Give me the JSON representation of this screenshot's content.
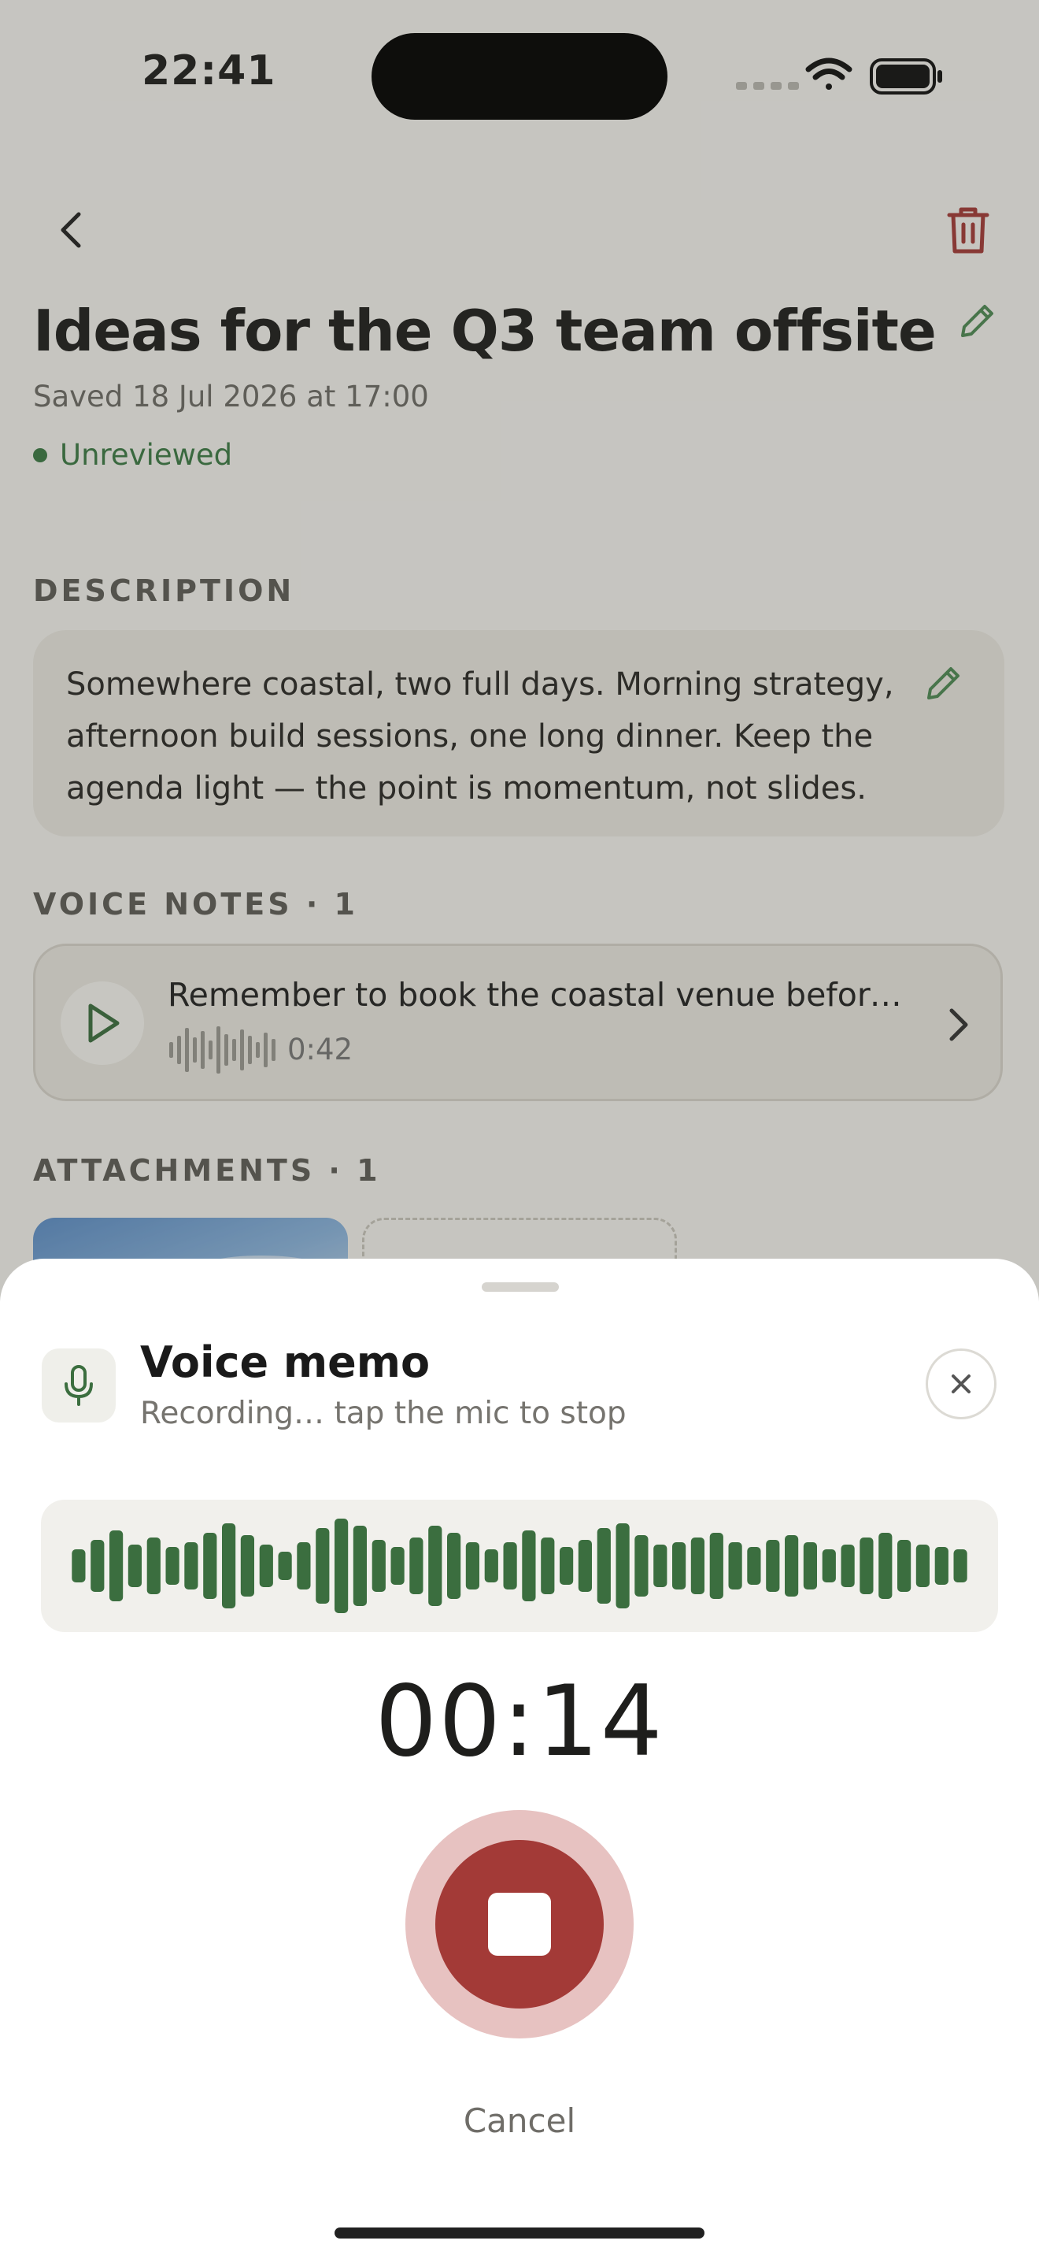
{
  "status_bar": {
    "time": "22:41"
  },
  "header": {
    "title": "Ideas for the Q3 team offsite",
    "saved": "Saved 18 Jul 2026 at 17:00",
    "status": "Unreviewed"
  },
  "description": {
    "label": "DESCRIPTION",
    "text": "Somewhere coastal, two full days. Morning strategy, afternoon build sessions, one long dinner. Keep the agenda light — the point is momentum, not slides."
  },
  "voice_notes": {
    "label": "VOICE NOTES · 1",
    "items": [
      {
        "title": "Remember to book the coastal venue before…",
        "duration": "0:42"
      }
    ]
  },
  "attachments": {
    "label": "ATTACHMENTS · 1"
  },
  "sheet": {
    "title": "Voice memo",
    "subtitle": "Recording… tap the mic to stop",
    "timer": "00:14",
    "cancel": "Cancel",
    "waveform_levels": [
      0.35,
      0.55,
      0.75,
      0.45,
      0.6,
      0.4,
      0.5,
      0.7,
      0.9,
      0.65,
      0.45,
      0.3,
      0.5,
      0.8,
      1.0,
      0.85,
      0.55,
      0.4,
      0.6,
      0.85,
      0.7,
      0.5,
      0.35,
      0.5,
      0.75,
      0.6,
      0.4,
      0.55,
      0.8,
      0.9,
      0.65,
      0.45,
      0.5,
      0.6,
      0.7,
      0.5,
      0.4,
      0.55,
      0.65,
      0.5,
      0.35,
      0.45,
      0.6,
      0.7,
      0.55,
      0.45,
      0.4,
      0.35
    ],
    "colors": {
      "accent": "#3b6e3f",
      "record": "#a33a37"
    }
  },
  "icons": {
    "back": "chevron-left-icon",
    "trash": "trash-icon",
    "edit": "pencil-icon",
    "play": "play-icon",
    "mic": "mic-icon",
    "close": "close-icon",
    "stop": "stop-icon"
  }
}
